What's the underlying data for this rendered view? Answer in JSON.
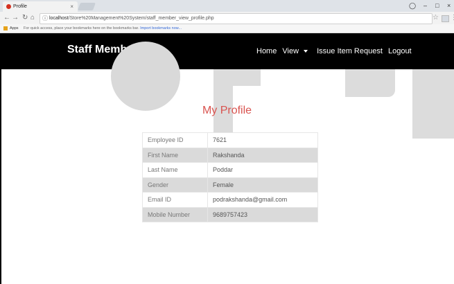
{
  "browser": {
    "tab_title": "Profile",
    "tab_close": "×",
    "url_host": "localhost",
    "url_path": "/Store%20Management%20System/staff_member_view_profile.php",
    "bookmarks_apps": "Apps",
    "bookmarks_msg": "For quick access, place your bookmarks here on the bookmarks bar.",
    "bookmarks_link": "Import bookmarks now..."
  },
  "navbar": {
    "brand": "Staff Member",
    "links": [
      "Home",
      "View",
      "Issue Item Request",
      "Logout"
    ]
  },
  "profile": {
    "title": "My Profile",
    "rows": [
      {
        "label": "Employee ID",
        "value": "7621"
      },
      {
        "label": "First Name",
        "value": "Rakshanda"
      },
      {
        "label": "Last Name",
        "value": "Poddar"
      },
      {
        "label": "Gender",
        "value": "Female"
      },
      {
        "label": "Email ID",
        "value": "podrakshanda@gmail.com"
      },
      {
        "label": "Mobile Number",
        "value": "9689757423"
      }
    ]
  },
  "colors": {
    "navbar_bg": "#000000",
    "title_red": "#d9534f",
    "stripe": "#dadada"
  },
  "icons": [
    "back-arrow-icon",
    "forward-arrow-icon",
    "reload-icon",
    "home-icon",
    "info-icon",
    "star-icon",
    "menu-dots-icon",
    "caret-down-icon"
  ]
}
